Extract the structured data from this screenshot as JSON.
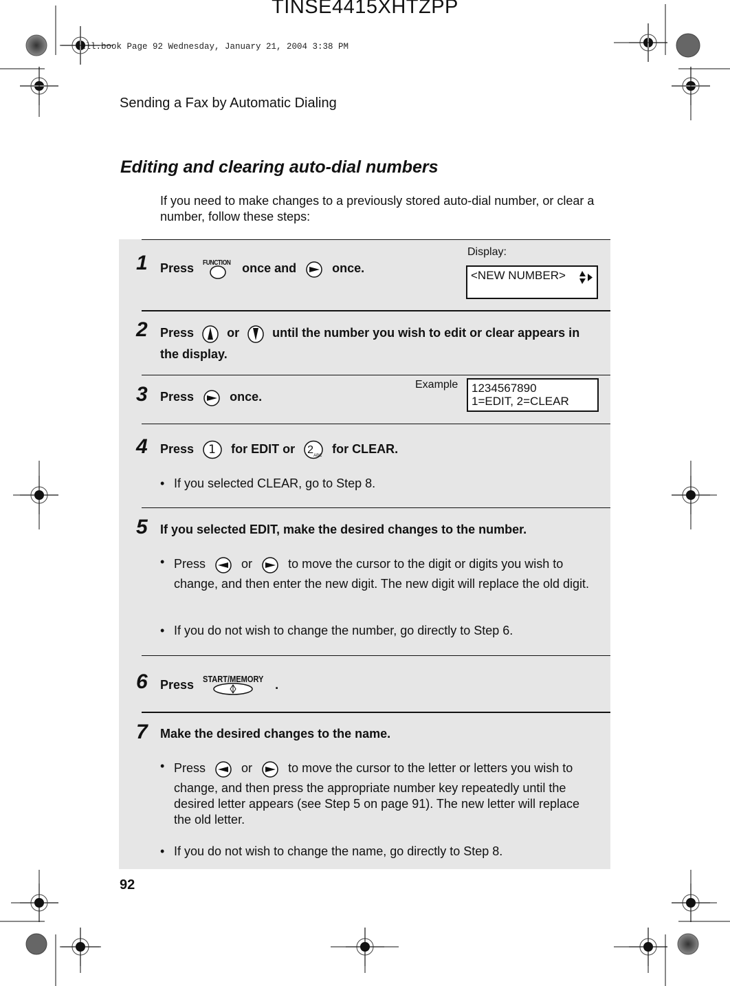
{
  "header": {
    "job_id": "TINSE4415XHTZPP",
    "book_info": "all.book  Page 92  Wednesday, January 21, 2004  3:38 PM",
    "running_head": "Sending a Fax by Automatic Dialing"
  },
  "section": {
    "title": "Editing and clearing auto-dial numbers",
    "intro": "If you need to make changes to a previously stored auto-dial number, or clear a number, follow these steps:"
  },
  "steps": [
    {
      "num": "1",
      "parts": [
        "Press",
        "once and",
        "once."
      ],
      "keys": {
        "function_label": "FUNCTION",
        "function": "function-key",
        "right": "right-arrow-key"
      }
    },
    {
      "num": "2",
      "parts": [
        "Press",
        "or",
        "until the number you wish to edit or clear appears in",
        "the display."
      ],
      "keys": {
        "up": "up-arrow-key",
        "down": "down-arrow-key"
      }
    },
    {
      "num": "3",
      "parts": [
        "Press",
        "once."
      ],
      "keys": {
        "right": "right-arrow-key"
      }
    },
    {
      "num": "4",
      "parts": [
        "Press",
        "for EDIT or",
        "for CLEAR."
      ],
      "keys": {
        "one": "1",
        "two": "2",
        "two_sub": "ABC"
      },
      "bullets": [
        "If you selected CLEAR, go to Step 8."
      ]
    },
    {
      "num": "5",
      "text": "If you selected EDIT, make the desired changes to the number.",
      "bullets": [
        {
          "pre": "Press",
          "mid": "or",
          "post_line1": "to move the cursor to the digit or digits you wish to",
          "rest": "change, and then enter the new digit. The new digit will replace the old digit."
        },
        "If you do not wish to change the number, go directly to Step 6."
      ]
    },
    {
      "num": "6",
      "parts": [
        "Press",
        "."
      ],
      "keys": {
        "start_label": "START/MEMORY"
      }
    },
    {
      "num": "7",
      "text": "Make the desired changes to the name.",
      "bullets": [
        {
          "pre": "Press",
          "mid": "or",
          "post_line1": "to move the cursor to the letter or letters you wish to",
          "rest": "change, and then press the appropriate number key repeatedly until the desired letter appears (see Step 5 on page 91). The new letter will replace the old letter."
        },
        "If you do not wish to change the name, go directly to Step 8."
      ]
    }
  ],
  "displays": {
    "display_label": "Display:",
    "display_line1": "<NEW NUMBER>",
    "example_label": "Example",
    "example_line1": "1234567890",
    "example_line2": "1=EDIT, 2=CLEAR"
  },
  "footer": {
    "page_number": "92"
  },
  "colors": {
    "panel": "#e6e6e6",
    "text": "#111111"
  }
}
